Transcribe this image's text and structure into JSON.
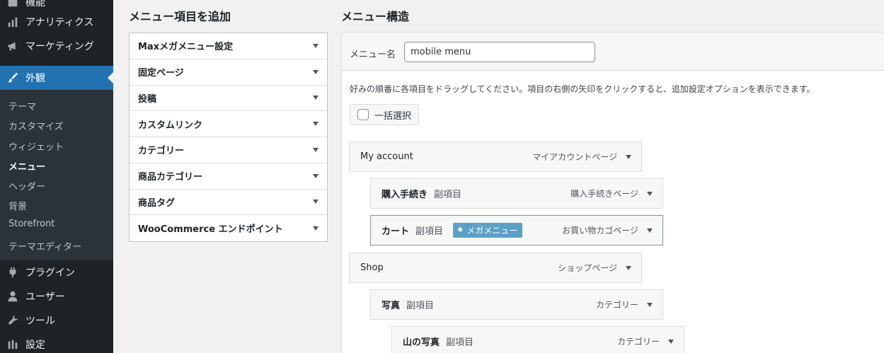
{
  "sidebar": {
    "top": [
      {
        "label": "機能",
        "icon": "tools-icon"
      },
      {
        "label": "アナリティクス",
        "icon": "bar-chart-icon"
      },
      {
        "label": "マーケティング",
        "icon": "megaphone-icon"
      },
      {
        "label": "外観",
        "icon": "paintbrush-icon"
      }
    ],
    "submenu": [
      "テーマ",
      "カスタマイズ",
      "ウィジェット",
      "メニュー",
      "ヘッダー",
      "背景",
      "Storefront",
      "テーマエディター"
    ],
    "bottom": [
      {
        "label": "プラグイン",
        "icon": "plugin-icon"
      },
      {
        "label": "ユーザー",
        "icon": "user-icon"
      },
      {
        "label": "ツール",
        "icon": "wrench-icon"
      },
      {
        "label": "設定",
        "icon": "settings-icon"
      }
    ]
  },
  "add_items": {
    "title": "メニュー項目を追加",
    "sections": [
      "Maxメガメニュー設定",
      "固定ページ",
      "投稿",
      "カスタムリンク",
      "カテゴリー",
      "商品カテゴリー",
      "商品タグ",
      "WooCommerce エンドポイント"
    ]
  },
  "structure": {
    "title": "メニュー構造",
    "name_label": "メニュー名",
    "name_value": "mobile menu",
    "instructions": "好みの順番に各項目をドラッグしてください。項目の右側の矢印をクリックすると、追加設定オプションを表示できます。",
    "bulk_select": "一括選択",
    "items": [
      {
        "title": "My account",
        "sub": "",
        "badge": "",
        "type": "マイアカウントページ"
      },
      {
        "title": "購入手続き",
        "sub": "副項目",
        "badge": "",
        "type": "購入手続きページ"
      },
      {
        "title": "カート",
        "sub": "副項目",
        "badge": "メガメニュー",
        "type": "お買い物カゴページ"
      },
      {
        "title": "Shop",
        "sub": "",
        "badge": "",
        "type": "ショップページ"
      },
      {
        "title": "写真",
        "sub": "副項目",
        "badge": "",
        "type": "カテゴリー"
      },
      {
        "title": "山の写真",
        "sub": "副項目",
        "badge": "",
        "type": "カテゴリー"
      }
    ]
  },
  "colors": {
    "sidebar": "#1d2327",
    "accent": "#2271b1",
    "badge": "#5aa1c9"
  }
}
